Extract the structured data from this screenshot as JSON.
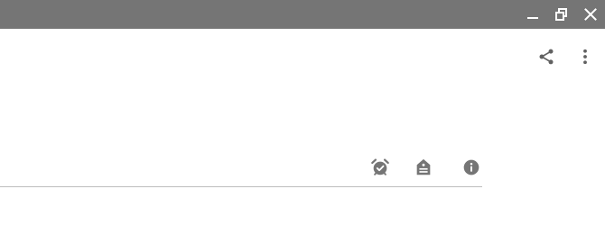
{
  "window": {
    "titlebar_color": "#757575",
    "controls": [
      {
        "name": "minimize-icon"
      },
      {
        "name": "restore-icon"
      },
      {
        "name": "close-icon"
      }
    ]
  },
  "toolbar": {
    "icon_color": "#616161",
    "items": [
      {
        "name": "share-icon"
      },
      {
        "name": "more-vertical-icon"
      }
    ]
  },
  "actions": {
    "icon_color": "#757575",
    "items": [
      {
        "name": "alarm-check-icon"
      },
      {
        "name": "label-icon"
      },
      {
        "name": "info-icon"
      }
    ]
  },
  "divider_color": "#bdbdbd"
}
